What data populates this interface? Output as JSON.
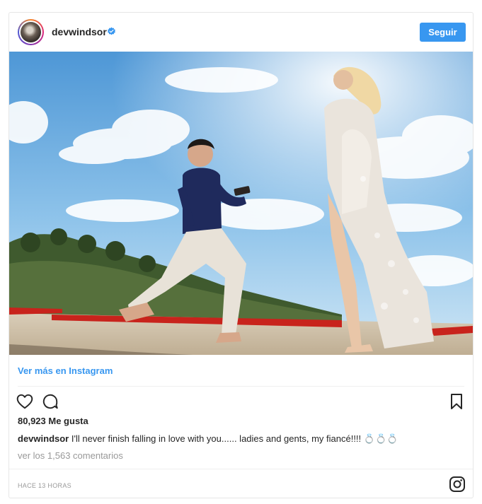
{
  "post": {
    "username": "devwindsor",
    "follow_label": "Seguir",
    "view_more_label": "Ver más en Instagram",
    "likes_count": "80,923",
    "likes_label": "Me gusta",
    "caption_user": "devwindsor",
    "caption_text": " I'll never finish falling in love with you...... ladies and gents, my fiancé!!!! 💍💍💍",
    "comments_link": "ver los 1,563 comentarios",
    "timestamp": "HACE 13 HORAS"
  },
  "colors": {
    "accent": "#3897f0",
    "muted": "#999999",
    "text": "#262626"
  },
  "icons": [
    "verified-badge-icon",
    "heart-icon",
    "comment-icon",
    "bookmark-icon",
    "instagram-logo-icon"
  ]
}
